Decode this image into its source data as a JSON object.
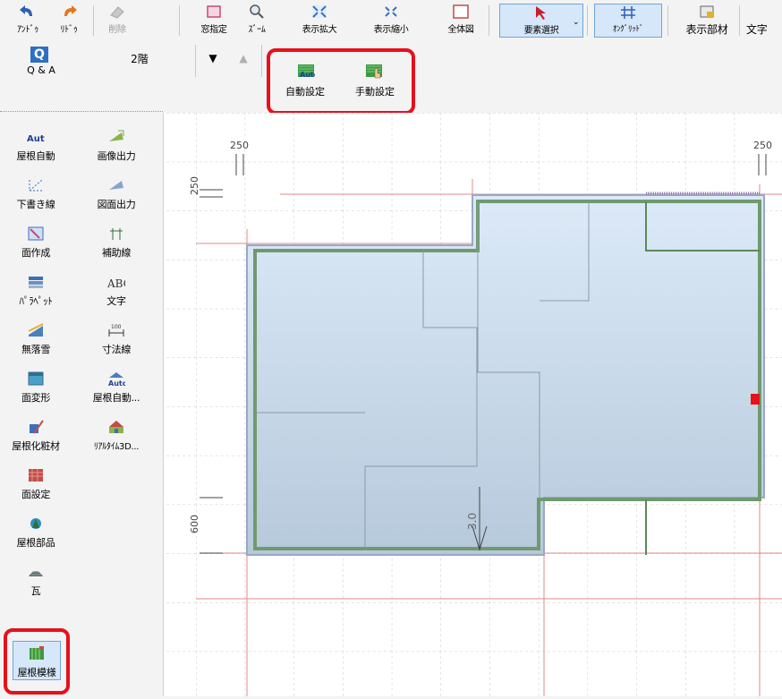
{
  "toolbar": {
    "undo": "ｱﾝﾄﾞｩ",
    "redo": "ﾘﾄﾞｩ",
    "delete": "削除",
    "window_select": "窓指定",
    "zoom": "ｽﾞｰﾑ",
    "zoom_in": "表示拡大",
    "zoom_out": "表示縮小",
    "full_view": "全体図",
    "element_select": "要素選択",
    "on_grid": "ｵﾝｸﾞﾘｯﾄﾞ",
    "display_members": "表示部材",
    "text": "文字"
  },
  "toolbar2": {
    "qa_icon": "Q",
    "qa": "Q & A",
    "floor": "2階",
    "auto_setting": "自動設定",
    "manual_setting": "手動設定"
  },
  "sidebar": {
    "items": [
      {
        "label": "屋根自動"
      },
      {
        "label": "画像出力"
      },
      {
        "label": "下書き線"
      },
      {
        "label": "図面出力"
      },
      {
        "label": "面作成"
      },
      {
        "label": "補助線"
      },
      {
        "label": "ﾊﾟﾗﾍﾟｯﾄ"
      },
      {
        "label": "文字"
      },
      {
        "label": "無落雪"
      },
      {
        "label": "寸法線"
      },
      {
        "label": "面変形"
      },
      {
        "label": "屋根自動..."
      },
      {
        "label": "屋根化粧材"
      },
      {
        "label": "ﾘｱﾙﾀｲﾑ3D..."
      },
      {
        "label": "面設定"
      },
      {
        "label": "屋根部品"
      },
      {
        "label": "瓦"
      },
      {
        "label": "屋根模様"
      }
    ]
  },
  "canvas": {
    "dim_top_left": "250",
    "dim_top_right": "250",
    "dim_left_top": "250",
    "dim_left_bottom": "600",
    "slope_label": "3.0"
  },
  "colors": {
    "highlight": "#e8101a",
    "roof_fill_top": "#dceaf8",
    "roof_fill_bottom": "#b6c9db",
    "roof_outline": "#5a8a5a",
    "selected_tool": "#d5e7f8"
  }
}
